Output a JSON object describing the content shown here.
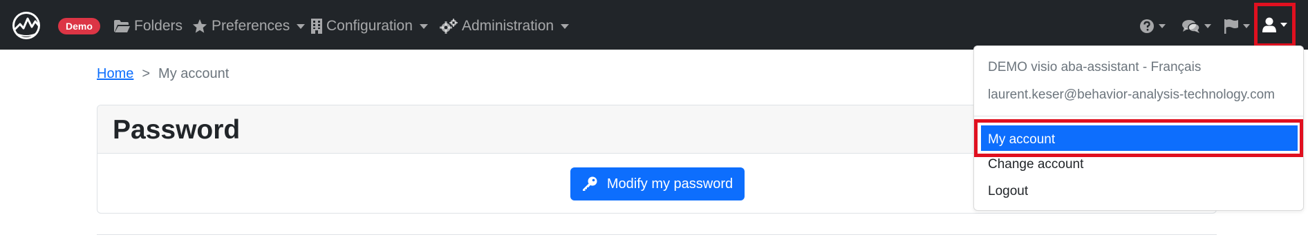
{
  "navbar": {
    "badge": "Demo",
    "items": [
      {
        "label": "Folders",
        "icon": "folder-open-icon"
      },
      {
        "label": "Preferences",
        "icon": "star-icon"
      },
      {
        "label": "Configuration",
        "icon": "building-icon"
      },
      {
        "label": "Administration",
        "icon": "cogs-icon"
      }
    ],
    "right_icons": [
      "help-icon",
      "comments-icon",
      "flag-icon",
      "user-icon"
    ]
  },
  "breadcrumb": {
    "home": "Home",
    "separator": ">",
    "current": "My account"
  },
  "card": {
    "title": "Password",
    "button": "Modify my password"
  },
  "dropdown": {
    "account_name": "DEMO visio aba-assistant - Français",
    "email": "laurent.keser@behavior-analysis-technology.com",
    "items": [
      "My account",
      "Change account",
      "Logout"
    ],
    "active_item": "My account"
  },
  "colors": {
    "navbar": "#212529",
    "primary": "#0d6efd",
    "badge": "#dc3545",
    "highlight": "#e0101f"
  }
}
